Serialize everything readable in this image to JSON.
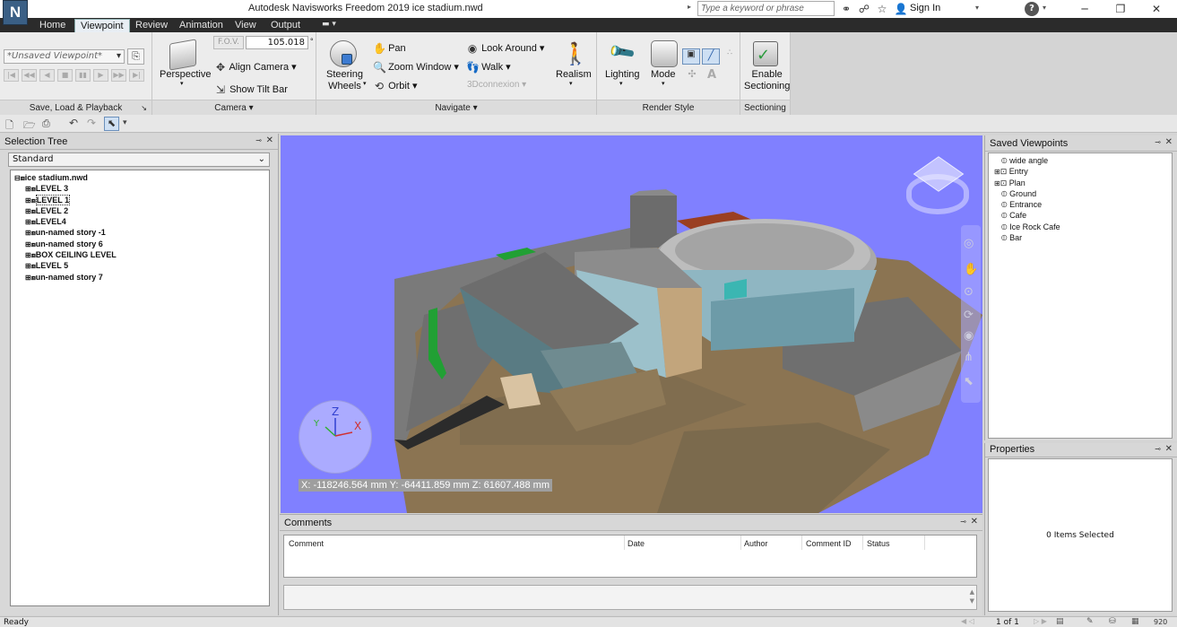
{
  "app": {
    "logo_text": "N",
    "window_title": "Autodesk Navisworks Freedom 2019    ice stadium.nwd"
  },
  "titlebar": {
    "search_placeholder": "Type a keyword or phrase",
    "sign_in": "Sign In"
  },
  "tabs": [
    "Home",
    "Viewpoint",
    "Review",
    "Animation",
    "View",
    "Output"
  ],
  "ribbon": {
    "panels": [
      "Save, Load & Playback",
      "Camera",
      "Navigate",
      "Render Style",
      "Sectioning"
    ],
    "viewpoint_select": "*Unsaved Viewpoint*",
    "camera": {
      "perspective": "Perspective",
      "fov_label": "F.O.V.",
      "fov_value": "105.018",
      "fov_unit": "°",
      "align": "Align Camera",
      "tilt": "Show Tilt Bar"
    },
    "navigate": {
      "steering1": "Steering",
      "steering2": "Wheels",
      "pan": "Pan",
      "zoom": "Zoom Window",
      "orbit": "Orbit",
      "look": "Look Around",
      "walk": "Walk",
      "connexion": "3Dconnexion",
      "realism": "Realism"
    },
    "render": {
      "lighting": "Lighting",
      "mode": "Mode"
    },
    "sectioning": {
      "line1": "Enable",
      "line2": "Sectioning"
    }
  },
  "selection_tree": {
    "title": "Selection Tree",
    "dropdown": "Standard",
    "root": "ice stadium.nwd",
    "items": [
      "LEVEL 3",
      "LEVEL 1",
      "LEVEL 2",
      "LEVEL4",
      "un-named story -1",
      "un-named story 6",
      "BOX CEILING LEVEL",
      "LEVEL 5",
      "un-named story 7"
    ]
  },
  "viewport": {
    "axis_x": "X",
    "axis_y": "Y",
    "axis_z": "Z",
    "coordinates": "X: -118246.564 mm  Y: -64411.859 mm  Z: 61607.488 mm"
  },
  "comments": {
    "title": "Comments",
    "columns": [
      "Comment",
      "Date",
      "Author",
      "Comment ID",
      "Status"
    ]
  },
  "saved_viewpoints": {
    "title": "Saved Viewpoints",
    "items": [
      {
        "label": "wide angle",
        "type": "view"
      },
      {
        "label": "Entry",
        "type": "folder"
      },
      {
        "label": "Plan",
        "type": "folder"
      },
      {
        "label": "Ground",
        "type": "view"
      },
      {
        "label": "Entrance",
        "type": "view"
      },
      {
        "label": "Cafe",
        "type": "view"
      },
      {
        "label": "Ice Rock Cafe",
        "type": "view"
      },
      {
        "label": "Bar",
        "type": "view"
      }
    ]
  },
  "properties": {
    "title": "Properties",
    "empty_text": "0 Items Selected"
  },
  "statusbar": {
    "status": "Ready",
    "page": "1 of 1",
    "memory": "920"
  }
}
